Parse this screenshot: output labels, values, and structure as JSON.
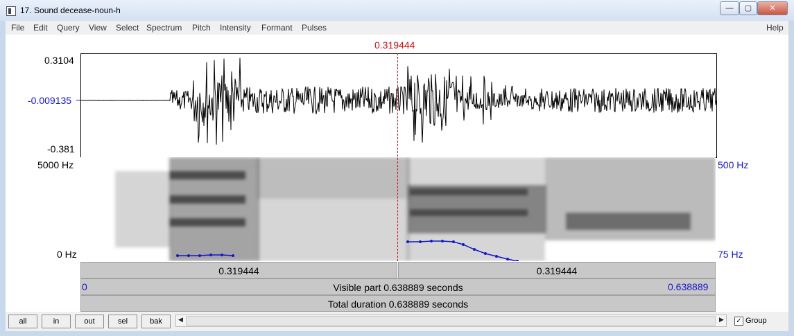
{
  "window": {
    "title": "17. Sound decease-noun-h",
    "buttons": {
      "minimize": "—",
      "maximize": "▢",
      "close": "✕"
    }
  },
  "menu": [
    "File",
    "Edit",
    "Query",
    "View",
    "Select",
    "Spectrum",
    "Pitch",
    "Intensity",
    "Formant",
    "Pulses"
  ],
  "help": "Help",
  "cursor_time": "0.319444",
  "waveform": {
    "y_max": "0.3104",
    "y_mid": "-0.009135",
    "y_min": "-0.381"
  },
  "spectrogram": {
    "freq_top": "5000 Hz",
    "freq_bottom": "0 Hz",
    "pitch_top": "500 Hz",
    "pitch_bottom": "75 Hz"
  },
  "segments": {
    "left": "0.319444",
    "right": "0.319444"
  },
  "visible": {
    "start": "0",
    "label": "Visible part 0.638889 seconds",
    "end": "0.638889"
  },
  "total": {
    "label": "Total duration 0.638889 seconds"
  },
  "bottom_buttons": [
    "all",
    "in",
    "out",
    "sel",
    "bak"
  ],
  "scroll": {
    "left_arrow": "◀",
    "right_arrow": "▶"
  },
  "group": {
    "label": "Group",
    "checked": "✓"
  },
  "colors": {
    "cursor": "#d01010",
    "pitch": "#1515d0",
    "axis_blue": "#1515d0"
  }
}
